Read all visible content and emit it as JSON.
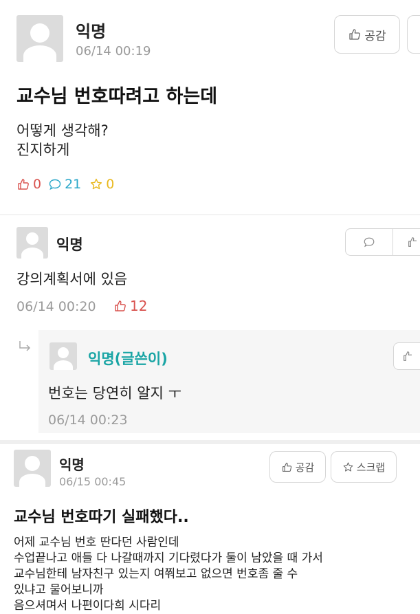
{
  "post1": {
    "author": "익명",
    "date": "06/14 00:19",
    "like_button": "공감",
    "title": "교수님 번호따려고 하는데",
    "body_line1": "어떻게 생각해?",
    "body_line2": "진지하게",
    "likes": "0",
    "comments": "21",
    "scraps": "0"
  },
  "comment1": {
    "author": "익명",
    "text": "강의계획서에 있음",
    "date": "06/14 00:20",
    "likes": "12"
  },
  "reply1": {
    "author": "익명(글쓴이)",
    "text": "번호는 당연히 알지 ㅜ",
    "date": "06/14 00:23"
  },
  "post2": {
    "author": "익명",
    "date": "06/15 00:45",
    "like_button": "공감",
    "scrap_button": "스크랩",
    "title": "교수님 번호따기 실패했다..",
    "body_lines": [
      "어제 교수님 번호 딴다던 사람인데",
      "수업끝나고 애들 다 나갈때까지 기다렸다가 둘이 남았을 때 가서",
      "교수님한테 남자친구 있는지 여쭤보고 없으면 번호좀 줄 수",
      "있냐고 물어보니까",
      "음으셔며서 나편이다희 시다리"
    ]
  },
  "colors": {
    "like_red": "#d9534f",
    "comment_cyan": "#2aa7c9",
    "scrap_yellow": "#e9b91f",
    "author_teal": "#1aa5a5",
    "meta_gray": "#9a9a9a"
  }
}
